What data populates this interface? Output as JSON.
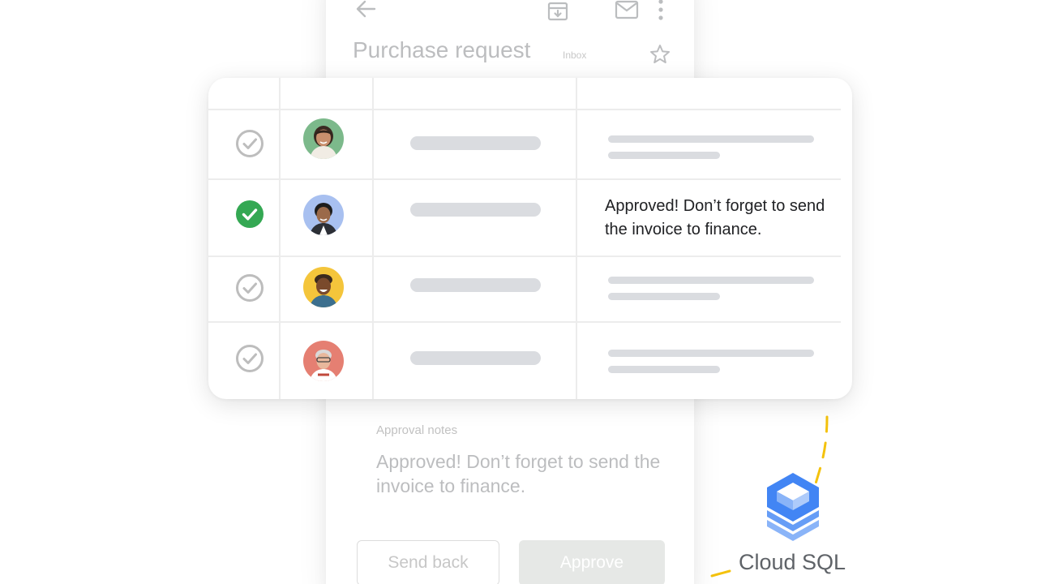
{
  "email": {
    "subject": "Purchase request",
    "inbox_chip": "Inbox",
    "notes_label": "Approval notes",
    "notes_text": "Approved! Don’t forget to send the invoice to finance.",
    "send_back_label": "Send back",
    "approve_label": "Approve",
    "icons": [
      "back-arrow-icon",
      "archive-icon",
      "mail-icon",
      "more-vert-icon",
      "star-icon"
    ]
  },
  "table": {
    "rows": [
      {
        "status": "pending",
        "avatar_bg": "#7cb98b",
        "note": ""
      },
      {
        "status": "approved",
        "avatar_bg": "#a8c0f0",
        "note": "Approved! Don’t forget to send the invoice to finance."
      },
      {
        "status": "pending",
        "avatar_bg": "#f4c53b",
        "note": ""
      },
      {
        "status": "pending",
        "avatar_bg": "#e57f72",
        "note": ""
      }
    ]
  },
  "product": {
    "label": "Cloud SQL",
    "icon": "cloud-sql-icon"
  },
  "colors": {
    "approved_green": "#34a853",
    "check_gray": "#bdbdbd",
    "sql_blue": "#4285f4",
    "dash_yellow": "#f4c20d"
  }
}
